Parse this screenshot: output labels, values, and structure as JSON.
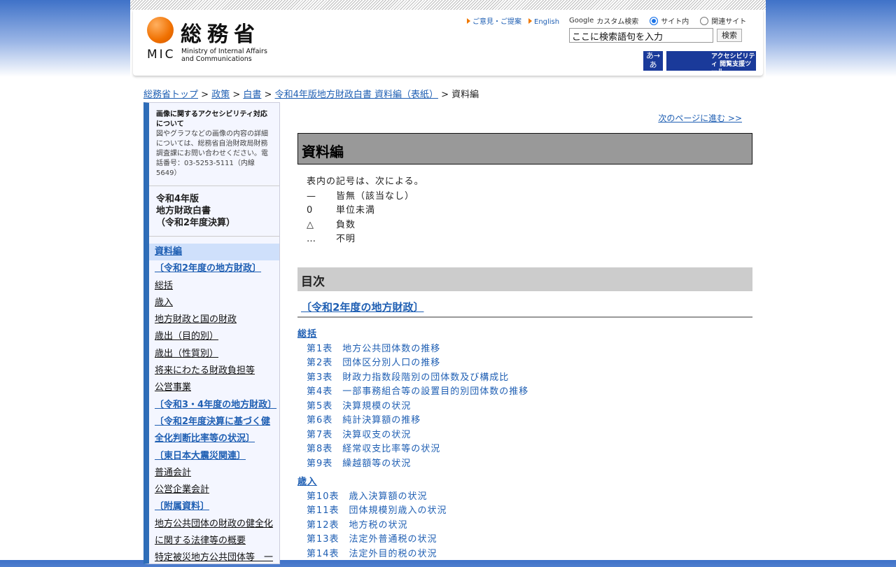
{
  "header": {
    "logo_kanji": "総務省",
    "logo_abbr": "MIC",
    "logo_en": "Ministry of Internal Affairs and Communications",
    "links": [
      "ご意見・ご提案",
      "English"
    ],
    "google_alt": "Google",
    "custom_search": "カスタム検索",
    "radio_site": "サイト内",
    "radio_related": "関連サイト",
    "search_value": "ここに検索語句を入力",
    "search_button": "検索",
    "text_size_label": "あ→あ",
    "accessibility_label": "アクセシビリティ 閲覧支援ツール"
  },
  "breadcrumb": [
    "総務省トップ",
    "政策",
    "白書",
    "令和4年版地方財政白書 資料編（表紙）",
    "資料編"
  ],
  "sidebar": {
    "note_title": "画像に関するアクセシビリティ対応について",
    "note_body": "図やグラフなどの画像の内容の詳細については、総務省自治財政局財務調査課にお問い合わせください。電話番号：03-5253-5111（内線5649）",
    "title_lines": [
      "令和4年版",
      "地方財政白書",
      "（令和2年度決算）"
    ],
    "items": [
      "資料編",
      "〔令和2年度の地方財政〕",
      "総括",
      "歳入",
      "地方財政と国の財政",
      "歳出（目的別）",
      "歳出（性質別）",
      "将来にわたる財政負担等",
      "公営事業",
      "〔令和3・4年度の地方財政〕",
      "〔令和2年度決算に基づく健全化判断比率等の状況〕",
      "〔東日本大震災関連〕",
      "普通会計",
      "公営企業会計",
      "〔附属資料〕",
      "地方公共団体の財政の健全化に関する法律等の概要",
      "特定被災地方公共団体等　一"
    ]
  },
  "main": {
    "next_link": "次のページに進む >>",
    "title": "資料編",
    "legend_intro": "表内の記号は、次による。",
    "legend": [
      {
        "symbol": "—",
        "meaning": "皆無（該当なし）"
      },
      {
        "symbol": "0",
        "meaning": "単位未満"
      },
      {
        "symbol": "△",
        "meaning": "負数"
      },
      {
        "symbol": "…",
        "meaning": "不明"
      }
    ],
    "toc_title": "目次",
    "section": "〔令和2年度の地方財政〕",
    "groups": [
      {
        "name": "総括",
        "items": [
          "第1表　地方公共団体数の推移",
          "第2表　団体区分別人口の推移",
          "第3表　財政力指数段階別の団体数及び構成比",
          "第4表　一部事務組合等の設置目的別団体数の推移",
          "第5表　決算規模の状況",
          "第6表　純計決算額の推移",
          "第7表　決算収支の状況",
          "第8表　経常収支比率等の状況",
          "第9表　繰越額等の状況"
        ]
      },
      {
        "name": "歳入",
        "items": [
          "第10表　歳入決算額の状況",
          "第11表　団体規模別歳入の状況",
          "第12表　地方税の状況",
          "第13表　法定外普通税の状況",
          "第14表　法定外目的税の状況"
        ]
      }
    ]
  }
}
